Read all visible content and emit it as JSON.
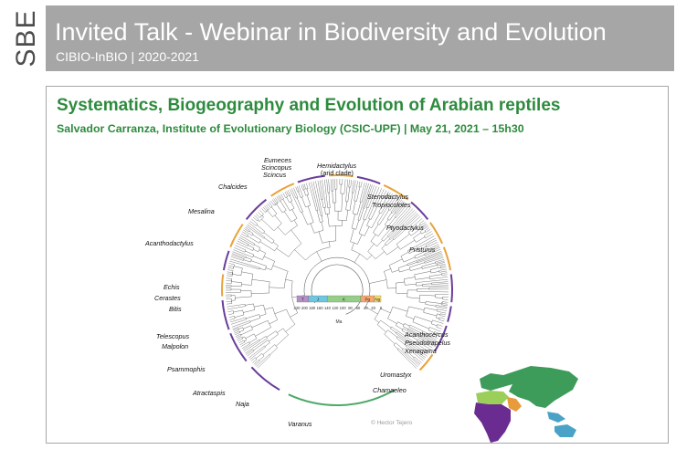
{
  "header": {
    "logo": "SBE",
    "title": "Invited Talk - Webinar in Biodiversity and Evolution",
    "subtitle": "CIBIO-InBIO | 2020-2021"
  },
  "talk": {
    "title": "Systematics, Biogeography and Evolution of Arabian reptiles",
    "subtitle": "Salvador Carranza, Institute of Evolutionary Biology (CSIC-UPF) | May 21, 2021 – 15h30"
  },
  "figure": {
    "taxa": {
      "eumeces": "Eumeces",
      "scincopus": "Scincopus",
      "scincus": "Scincus",
      "hemidactylus": "Hemidactylus",
      "arid_clade": "(arid clade)",
      "chalcides": "Chalcides",
      "stenodactylus": "Stenodactylus",
      "tropiocolotes": "Tropiocolotes",
      "mesalina": "Mesalina",
      "ptyodactylus": "Ptyodactylus",
      "acanthodactylus": "Acanthodactylus",
      "pristurus": "Pristurus",
      "echis": "Echis",
      "cerastes": "Cerastes",
      "bitis": "Bitis",
      "telescopus": "Telescopus",
      "malpolon": "Malpolon",
      "acanthocercus": "Acanthocercus",
      "pseudotrapelus": "Pseudotrapelus",
      "xenagama": "Xenagama",
      "psammophis": "Psammophis",
      "uromastyx": "Uromastyx",
      "atractaspis": "Atractaspis",
      "chamaeleo": "Chamaeleo",
      "naja": "Naja",
      "varanus": "Varanus"
    },
    "timescale": {
      "periods": [
        "T",
        "J",
        "K",
        "Pg",
        "Ng"
      ],
      "ticks": [
        "220",
        "200",
        "180",
        "160",
        "140",
        "120",
        "100",
        "80",
        "60",
        "40",
        "20",
        "0"
      ],
      "unit": "Ma",
      "colors": [
        "#b58fc6",
        "#6cc7e0",
        "#94cf88",
        "#f7a66d",
        "#f5dc6b"
      ]
    },
    "credit": "© Hector Tejero",
    "clade_colors": {
      "purple": "#6a3d9a",
      "orange": "#e8a33d",
      "green": "#4fa86a",
      "grey": "#777777"
    },
    "map_colors": {
      "africa": "#6b2c91",
      "arabia": "#e89b3a",
      "eurasia": "#3e9c5a",
      "asia": "#4aa3c7",
      "sahara": "#9bcf5a"
    }
  }
}
